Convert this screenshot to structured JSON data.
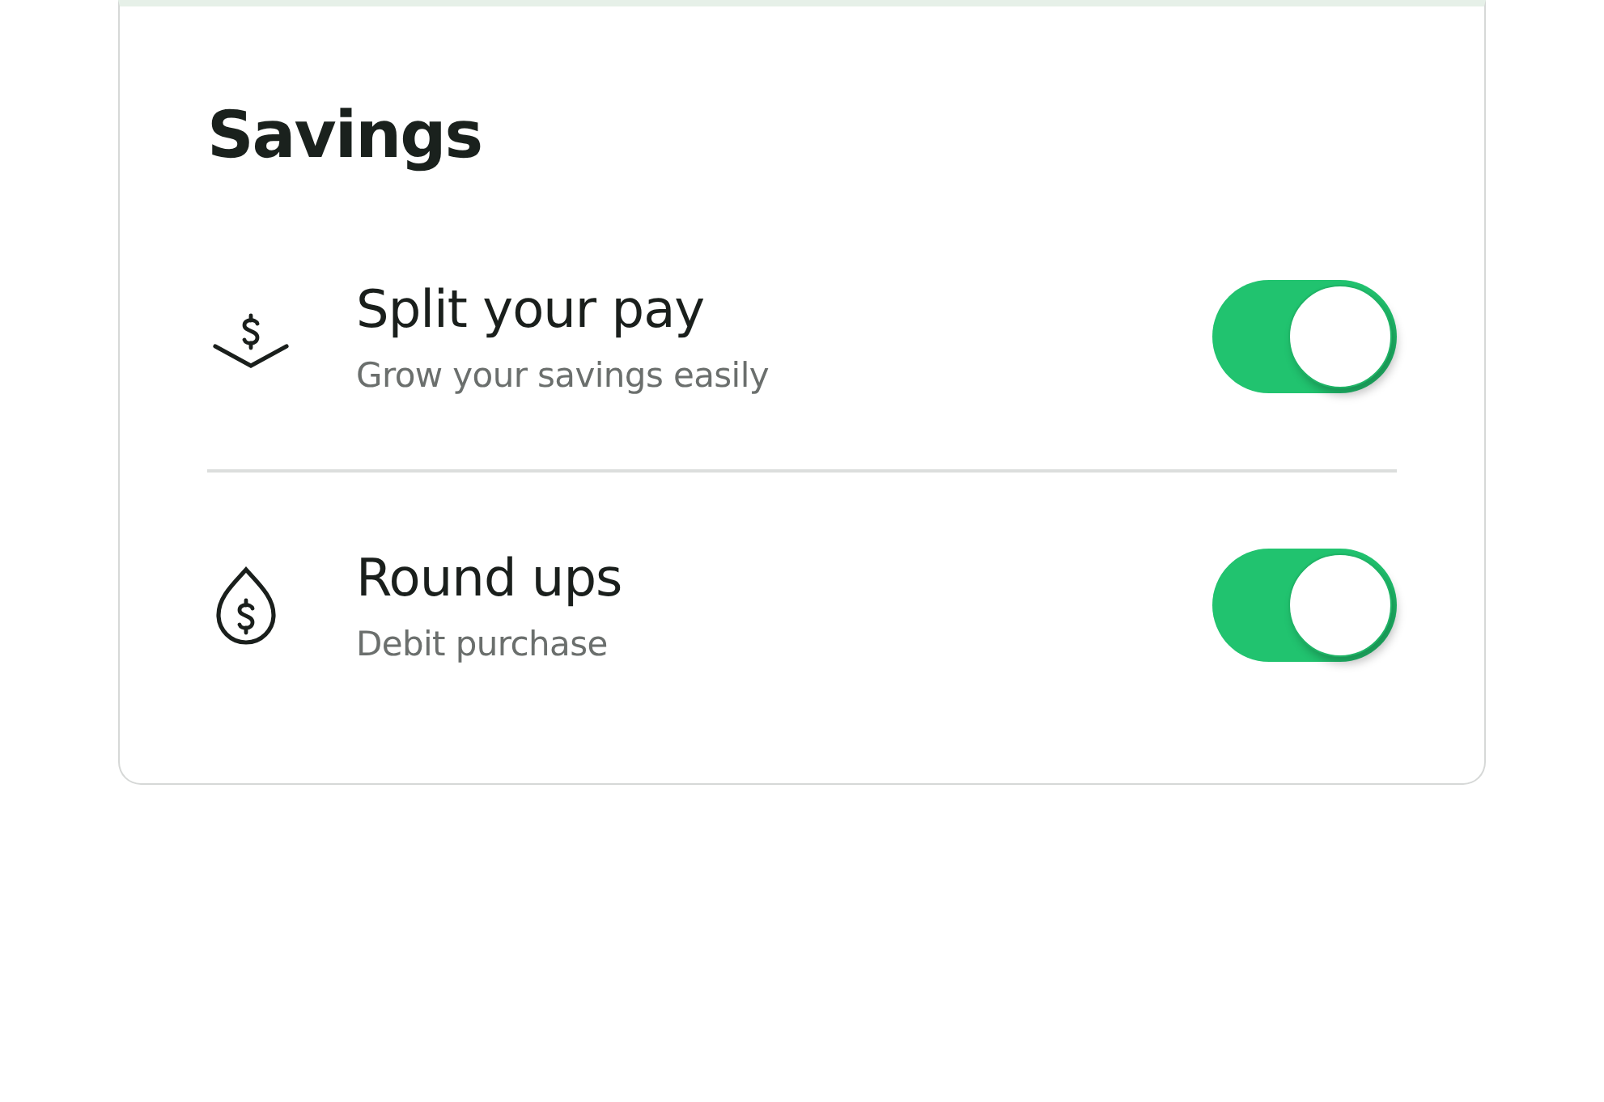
{
  "card": {
    "title": "Savings"
  },
  "settings": [
    {
      "kind": "split",
      "label": "Split your pay",
      "description": "Grow your savings easily",
      "on": true
    },
    {
      "kind": "roundup",
      "label": "Round ups",
      "description": "Debit purchase",
      "on": true
    }
  ]
}
